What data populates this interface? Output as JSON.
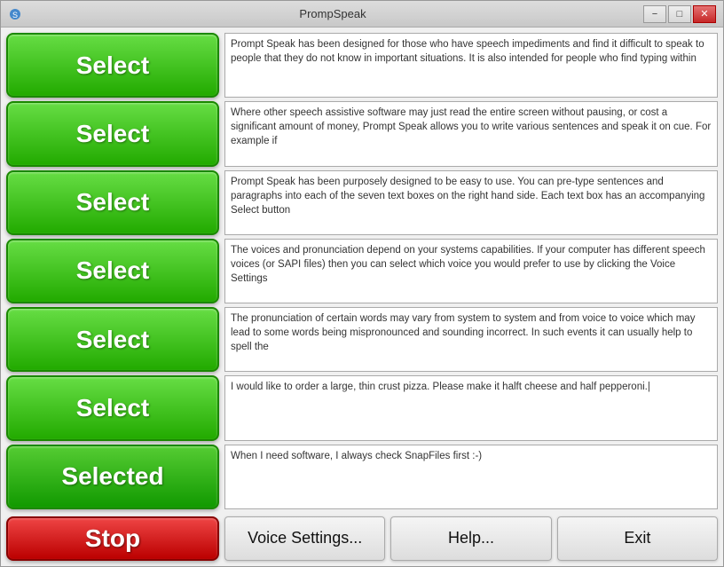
{
  "window": {
    "title": "PrompSpeak",
    "icon": "speak-icon"
  },
  "title_bar": {
    "minimize_label": "−",
    "maximize_label": "□",
    "close_label": "✕"
  },
  "rows": [
    {
      "id": "row1",
      "button_label": "Select",
      "text": "Prompt Speak has been designed for those who have speech impediments and find it difficult to speak to people that they do not know in important situations. It is also intended for people who find typing within",
      "selected": false
    },
    {
      "id": "row2",
      "button_label": "Select",
      "text": "Where other speech assistive software may just read the entire screen without pausing, or cost a significant amount of money, Prompt Speak allows you to write various sentences and speak it on cue. For example if",
      "selected": false
    },
    {
      "id": "row3",
      "button_label": "Select",
      "text": "Prompt Speak has been purposely designed to be easy to use. You can pre-type sentences and paragraphs into each of the seven text boxes on the right hand side. Each text box has an accompanying Select button",
      "selected": false
    },
    {
      "id": "row4",
      "button_label": "Select",
      "text": "The voices and pronunciation depend on your systems capabilities. If your computer has different speech voices (or SAPI files) then you can select which voice you would prefer to use by clicking the Voice Settings",
      "selected": false
    },
    {
      "id": "row5",
      "button_label": "Select",
      "text": "The pronunciation of certain words may vary from system to system and from voice to voice which may lead to some words being mispronounced and sounding incorrect. In such events it can usually help to spell the",
      "selected": false
    },
    {
      "id": "row6",
      "button_label": "Select",
      "text": "I would like to order a large, thin crust pizza. Please make it halft cheese and half pepperoni.|",
      "selected": false
    },
    {
      "id": "row7",
      "button_label": "Selected",
      "text": "When I need software, I always check SnapFiles first :-)",
      "selected": true
    }
  ],
  "bottom": {
    "stop_label": "Stop",
    "voice_settings_label": "Voice Settings...",
    "help_label": "Help...",
    "exit_label": "Exit"
  }
}
